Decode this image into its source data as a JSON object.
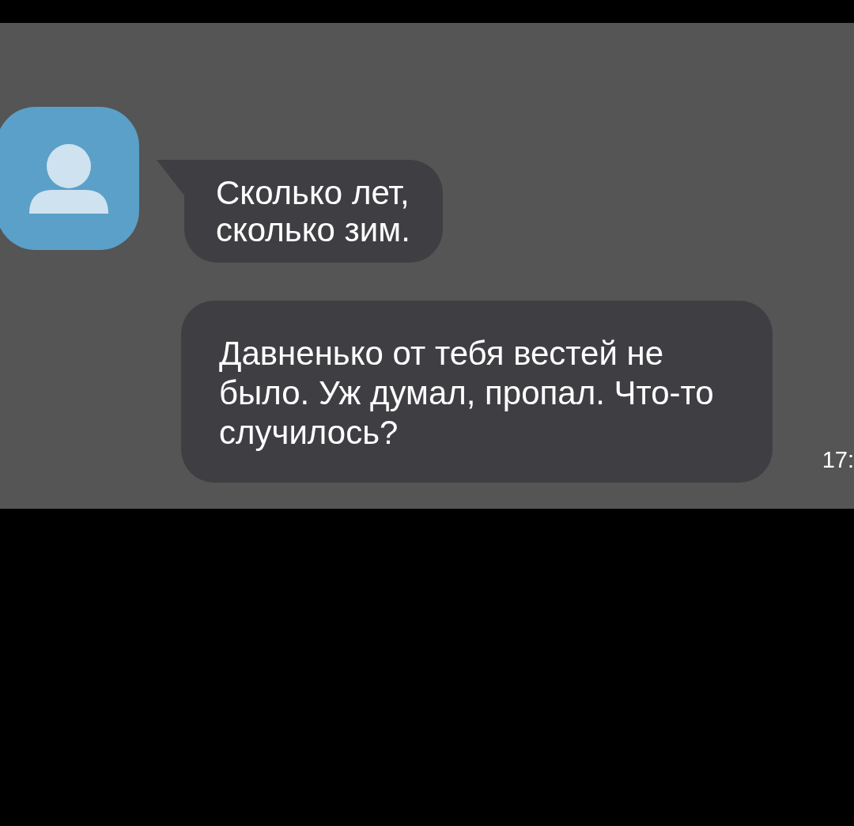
{
  "messages": [
    {
      "kind": "incoming",
      "text": "Сколько лет, сколько зим."
    },
    {
      "kind": "outgoing",
      "text": "Давненько от тебя вестей не было. Уж думал, пропал. Что-то случилось?",
      "time": "17:"
    }
  ]
}
